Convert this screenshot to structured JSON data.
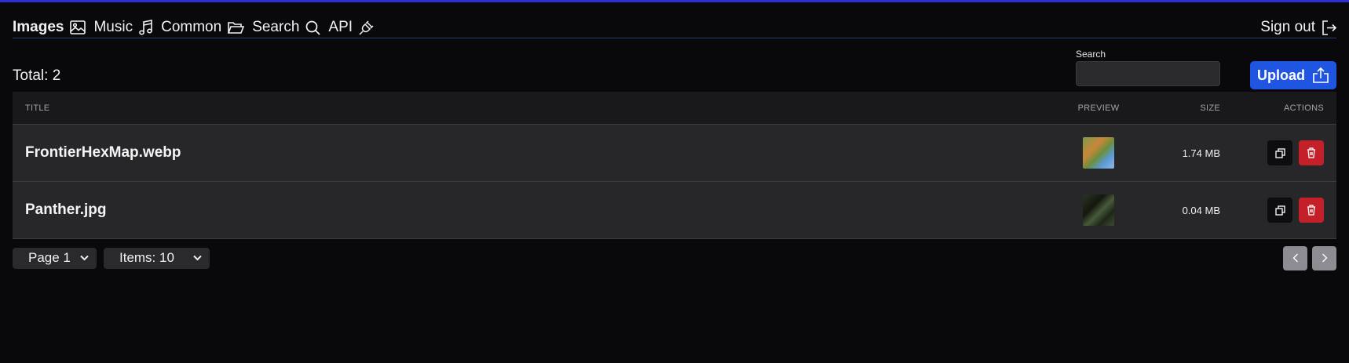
{
  "nav": {
    "items": [
      {
        "label": "Images",
        "icon": "image-icon",
        "active": true
      },
      {
        "label": "Music",
        "icon": "music-note-icon"
      },
      {
        "label": "Common",
        "icon": "folder-open-icon"
      },
      {
        "label": "Search",
        "icon": "search-icon"
      },
      {
        "label": "API",
        "icon": "plug-icon"
      }
    ],
    "sign_out": {
      "label": "Sign out",
      "icon": "sign-out-icon"
    }
  },
  "toolbar": {
    "total_label": "Total: 2",
    "search_label": "Search",
    "search_value": "",
    "upload_label": "Upload",
    "upload_icon": "upload-icon"
  },
  "table": {
    "columns": [
      "TITLE",
      "PREVIEW",
      "SIZE",
      "ACTIONS"
    ],
    "rows": [
      {
        "title": "FrontierHexMap.webp",
        "size": "1.74 MB"
      },
      {
        "title": "Panther.jpg",
        "size": "0.04 MB"
      }
    ]
  },
  "footer": {
    "page_select": "Page 1",
    "items_select": "Items: 10"
  },
  "colors": {
    "accent": "#1f55e0",
    "danger": "#c3202a",
    "top_bar": "#2f2fd0",
    "background": "#09090b"
  }
}
